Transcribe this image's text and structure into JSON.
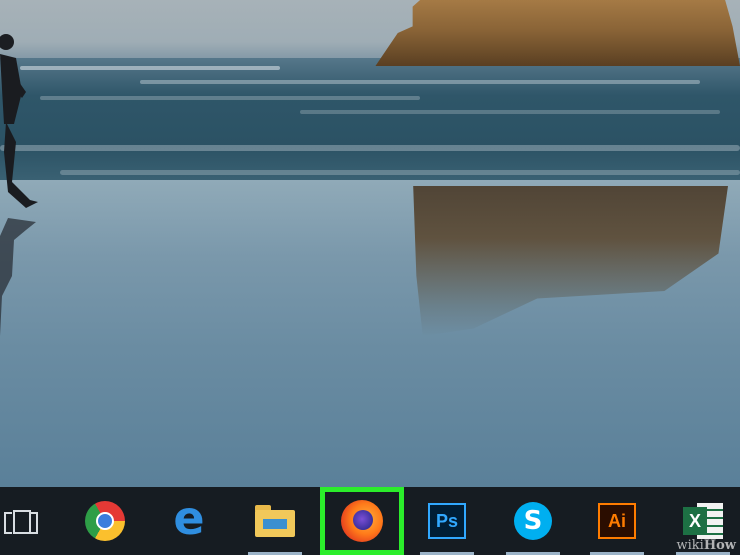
{
  "screen": {
    "wallpaper": "beach-with-rock-and-runner",
    "taskbar": {
      "background": "#161c22",
      "highlight_color": "#2bed2b",
      "items": [
        {
          "name": "task-view",
          "icon": "task-view-icon",
          "active": false
        },
        {
          "name": "Google Chrome",
          "icon": "chrome-icon",
          "active": false
        },
        {
          "name": "Microsoft Edge",
          "icon": "edge-icon",
          "glyph": "e",
          "active": false
        },
        {
          "name": "File Explorer",
          "icon": "folder-icon",
          "active": true
        },
        {
          "name": "Firefox",
          "icon": "firefox-icon",
          "active": true,
          "highlighted": true
        },
        {
          "name": "Adobe Photoshop",
          "icon": "photoshop-icon",
          "glyph": "Ps",
          "active": true
        },
        {
          "name": "Skype",
          "icon": "skype-icon",
          "glyph": "S",
          "active": true
        },
        {
          "name": "Adobe Illustrator",
          "icon": "illustrator-icon",
          "glyph": "Ai",
          "active": true
        },
        {
          "name": "Microsoft Excel",
          "icon": "excel-icon",
          "glyph": "X",
          "active": true
        }
      ]
    },
    "watermark": {
      "prefix": "wiki",
      "suffix": "How"
    }
  }
}
